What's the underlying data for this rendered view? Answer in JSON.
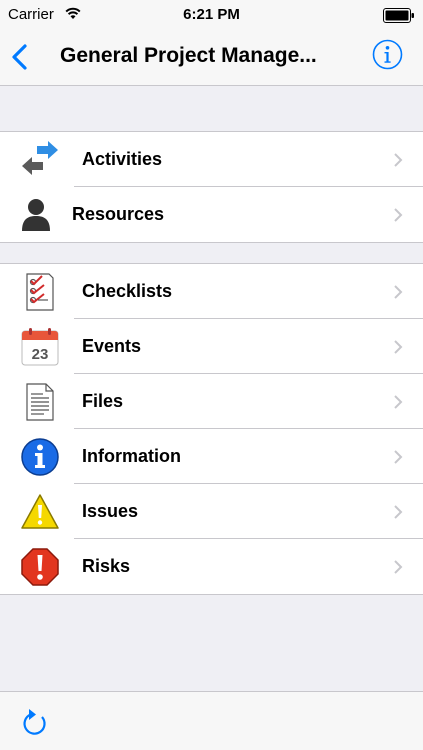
{
  "status": {
    "carrier": "Carrier",
    "time": "6:21 PM",
    "icons": {
      "wifi": "wifi-icon",
      "battery": "battery-icon"
    }
  },
  "nav": {
    "title": "General Project Manage...",
    "back_icon": "chevron-left-icon",
    "info_icon": "info-circle-icon",
    "accent": "#007aff"
  },
  "groups": [
    {
      "items": [
        {
          "label": "Activities",
          "icon": "activities-arrows-icon"
        },
        {
          "label": "Resources",
          "icon": "person-icon"
        }
      ]
    },
    {
      "items": [
        {
          "label": "Checklists",
          "icon": "checklist-icon"
        },
        {
          "label": "Events",
          "icon": "calendar-icon",
          "icon_text": "23"
        },
        {
          "label": "Files",
          "icon": "document-icon"
        },
        {
          "label": "Information",
          "icon": "information-icon"
        },
        {
          "label": "Issues",
          "icon": "warning-icon"
        },
        {
          "label": "Risks",
          "icon": "stop-icon"
        }
      ]
    }
  ],
  "toolbar": {
    "refresh_icon": "refresh-icon"
  },
  "colors": {
    "background": "#efeff4",
    "bar": "#f7f7f7",
    "separator": "#c8c7cc",
    "chevron": "#c7c7cc"
  }
}
